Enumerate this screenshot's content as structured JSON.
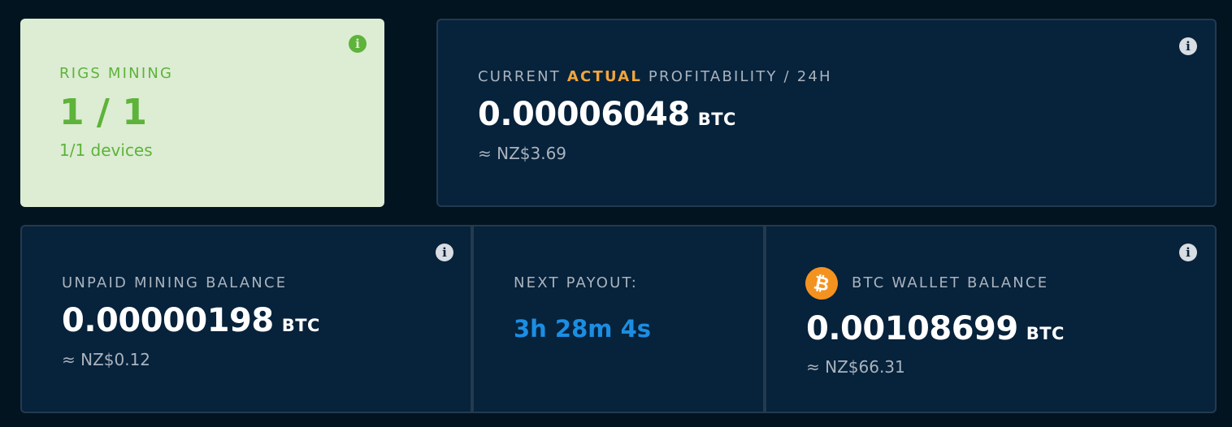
{
  "rigs": {
    "label": "RIGS MINING",
    "value": "1 / 1",
    "devices": "1/1 devices"
  },
  "profitability": {
    "label_prefix": "CURRENT ",
    "label_accent": "ACTUAL",
    "label_suffix": " PROFITABILITY / 24H",
    "value": "0.00006048",
    "unit": "BTC",
    "fiat": "≈ NZ$3.69"
  },
  "unpaid": {
    "label": "UNPAID MINING BALANCE",
    "value": "0.00000198",
    "unit": "BTC",
    "fiat": "≈ NZ$0.12"
  },
  "payout": {
    "label": "NEXT PAYOUT:",
    "value": "3h 28m 4s"
  },
  "wallet": {
    "label": "BTC WALLET BALANCE",
    "value": "0.00108699",
    "unit": "BTC",
    "fiat": "≈ NZ$66.31",
    "icon_glyph": "₿"
  },
  "icons": {
    "info": "i"
  },
  "colors": {
    "accent_orange": "#f1a53b",
    "success_green": "#5eb33a",
    "payout_blue": "#1b8ee3",
    "bitcoin_orange": "#f4921f"
  }
}
